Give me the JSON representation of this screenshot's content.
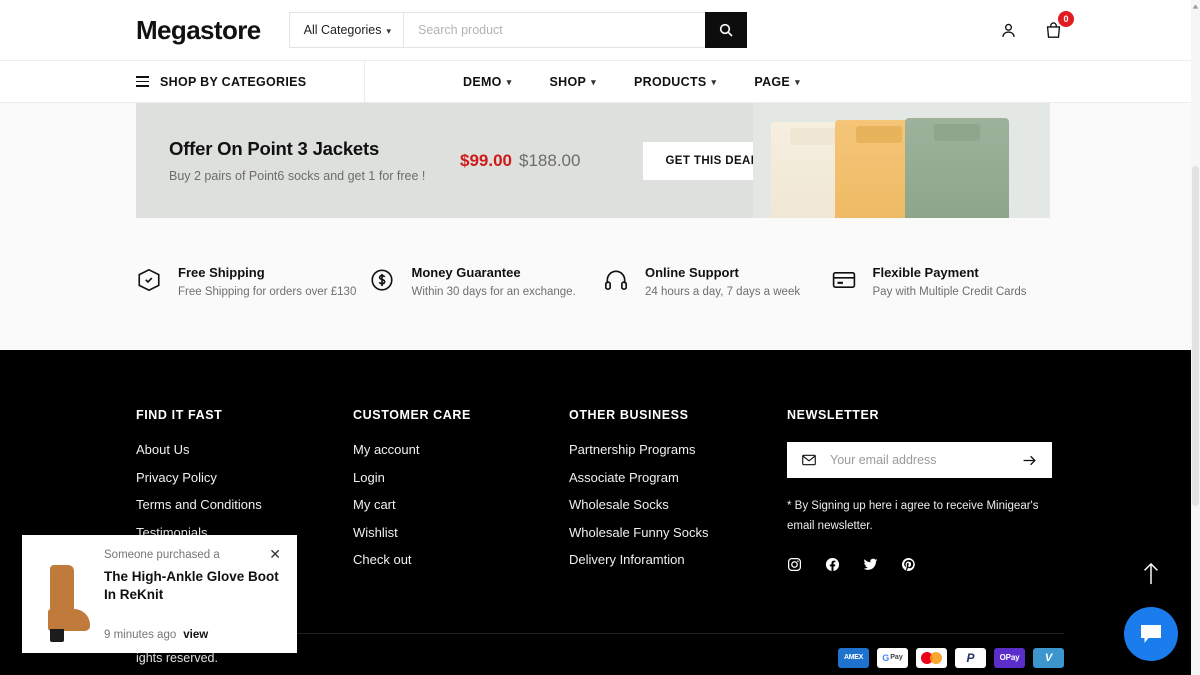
{
  "header": {
    "logo": "Megastore",
    "search": {
      "category_label": "All Categories",
      "placeholder": "Search product"
    },
    "account_icon": "user-icon",
    "cart_icon": "shopping-bag-icon",
    "cart_count": "0"
  },
  "nav": {
    "shop_by_categories": "SHOP BY CATEGORIES",
    "links": [
      {
        "label": "DEMO"
      },
      {
        "label": "SHOP"
      },
      {
        "label": "PRODUCTS"
      },
      {
        "label": "PAGE"
      }
    ]
  },
  "banner": {
    "title": "Offer On Point 3 Jackets",
    "subtitle": "Buy 2 pairs of Point6 socks and get 1 for free !",
    "price_new": "$99.00",
    "price_old": "$188.00",
    "cta": "GET THIS DEAL"
  },
  "features": [
    {
      "icon": "box-check-icon",
      "title": "Free Shipping",
      "sub": "Free Shipping for orders over £130"
    },
    {
      "icon": "dollar-circle-icon",
      "title": "Money Guarantee",
      "sub": "Within 30 days for an exchange."
    },
    {
      "icon": "headphones-icon",
      "title": "Online Support",
      "sub": "24 hours a day, 7 days a week"
    },
    {
      "icon": "credit-card-icon",
      "title": "Flexible Payment",
      "sub": "Pay with Multiple Credit Cards"
    }
  ],
  "footer": {
    "columns": [
      {
        "heading": "FIND IT FAST",
        "links": [
          "About Us",
          "Privacy Policy",
          "Terms and Conditions",
          "Testimonials"
        ]
      },
      {
        "heading": "CUSTOMER CARE",
        "links": [
          "My account",
          "Login",
          "My cart",
          "Wishlist",
          "Check out"
        ]
      },
      {
        "heading": "OTHER BUSINESS",
        "links": [
          "Partnership Programs",
          "Associate Program",
          "Wholesale Socks",
          "Wholesale Funny Socks",
          "Delivery Inforamtion"
        ]
      }
    ],
    "newsletter": {
      "heading": "NEWSLETTER",
      "placeholder": "Your email address",
      "mail_icon": "envelope-icon",
      "submit_icon": "arrow-right-icon",
      "note": "* By Signing up here i agree to receive Minigear's email newsletter."
    },
    "socials": [
      {
        "name": "instagram-icon"
      },
      {
        "name": "facebook-icon"
      },
      {
        "name": "twitter-icon"
      },
      {
        "name": "pinterest-icon"
      }
    ],
    "copyright": "ights reserved.",
    "payments": [
      {
        "name": "amex",
        "label": "AMEX"
      },
      {
        "name": "google-pay",
        "label": "Pay"
      },
      {
        "name": "mastercard",
        "label": ""
      },
      {
        "name": "paypal",
        "label": "P"
      },
      {
        "name": "opay",
        "label": "OPay"
      },
      {
        "name": "venmo",
        "label": "V"
      }
    ]
  },
  "popup": {
    "kicker": "Someone purchased a",
    "title": "The High-Ankle Glove Boot In ReKnit",
    "time": "9 minutes ago",
    "view": "view",
    "close_icon": "close-icon",
    "product_image": "ankle-boot-thumbnail"
  },
  "floating": {
    "to_top_icon": "arrow-up-icon",
    "chat_icon": "chat-bubble-icon",
    "chat_color": "#1b7ded"
  }
}
